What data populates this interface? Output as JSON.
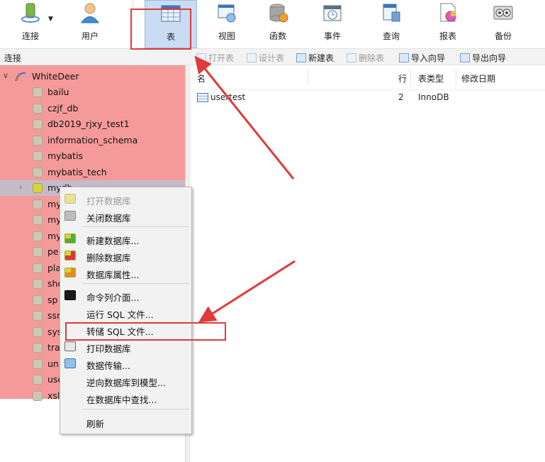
{
  "toolbar": {
    "buttons": [
      {
        "id": "connect",
        "label": "连接",
        "icon": "connection-icon"
      },
      {
        "id": "user",
        "label": "用户",
        "icon": "user-icon"
      },
      {
        "id": "table",
        "label": "表",
        "icon": "table-icon",
        "active": true
      },
      {
        "id": "view",
        "label": "视图",
        "icon": "view-icon"
      },
      {
        "id": "function",
        "label": "函数",
        "icon": "function-icon"
      },
      {
        "id": "event",
        "label": "事件",
        "icon": "event-icon"
      },
      {
        "id": "query",
        "label": "查询",
        "icon": "query-icon"
      },
      {
        "id": "report",
        "label": "报表",
        "icon": "report-icon"
      },
      {
        "id": "backup",
        "label": "备份",
        "icon": "backup-icon"
      }
    ]
  },
  "header": {
    "connection_label": "连接",
    "object_buttons": [
      {
        "label": "打开表",
        "enabled": false
      },
      {
        "label": "设计表",
        "enabled": false
      },
      {
        "label": "新建表",
        "enabled": true
      },
      {
        "label": "删除表",
        "enabled": false
      },
      {
        "label": "导入向导",
        "enabled": true
      },
      {
        "label": "导出向导",
        "enabled": true
      }
    ]
  },
  "tree": {
    "connection_name": "WhiteDeer",
    "databases": [
      "bailu",
      "czjf_db",
      "db2019_rjxy_test1",
      "information_schema",
      "mybatis",
      "mybatis_tech",
      "mydb",
      "my",
      "my",
      "my",
      "pe",
      "pla",
      "sho",
      "sp",
      "ssr",
      "sys",
      "tra",
      "un",
      "use",
      "xsl"
    ],
    "selected_index": 6
  },
  "table_list": {
    "columns": {
      "name": "名",
      "rows": "行",
      "type": "表类型",
      "modified": "修改日期"
    },
    "rows": [
      {
        "name": "usertest",
        "rows": "2",
        "type": "InnoDB",
        "modified": ""
      }
    ]
  },
  "context_menu": {
    "items": [
      {
        "label": "打开数据库",
        "enabled": false,
        "icon": "database-open-icon"
      },
      {
        "label": "关闭数据库",
        "enabled": true,
        "icon": "database-close-icon"
      },
      {
        "label": "新建数据库...",
        "enabled": true,
        "icon": "database-new-icon"
      },
      {
        "label": "删除数据库",
        "enabled": true,
        "icon": "database-delete-icon"
      },
      {
        "label": "数据库属性...",
        "enabled": true,
        "icon": "database-properties-icon"
      },
      {
        "label": "命令列介面...",
        "enabled": true,
        "icon": "console-icon"
      },
      {
        "label": "运行 SQL 文件...",
        "enabled": true,
        "icon": ""
      },
      {
        "label": "转储 SQL 文件...",
        "enabled": true,
        "icon": "",
        "highlighted": true
      },
      {
        "label": "打印数据库",
        "enabled": true,
        "icon": "print-icon"
      },
      {
        "label": "数据传输...",
        "enabled": true,
        "icon": "data-transfer-icon"
      },
      {
        "label": "逆向数据库到模型...",
        "enabled": true,
        "icon": ""
      },
      {
        "label": "在数据库中查找...",
        "enabled": true,
        "icon": ""
      },
      {
        "label": "刷新",
        "enabled": true,
        "icon": ""
      }
    ]
  },
  "colors": {
    "annotation_red": "#e03a3a",
    "tree_highlight": "#f59a9a",
    "toolbar_active": "#c9dcf3"
  }
}
